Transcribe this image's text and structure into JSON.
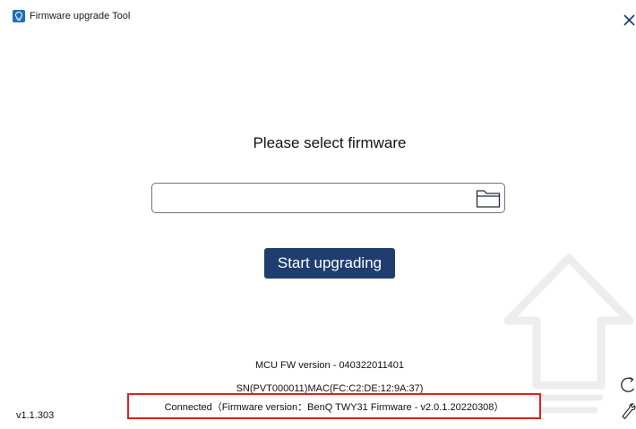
{
  "window": {
    "title": "Firmware upgrade Tool",
    "close_glyph": "X"
  },
  "main": {
    "heading": "Please select firmware",
    "firmware_path": "",
    "start_button_label": "Start upgrading"
  },
  "device": {
    "mcu_fw_version": "MCU FW version - 040322011401",
    "serial_mac": "SN(PVT000011)MAC(FC:C2:DE:12:9A:37)",
    "connection_status": "Connected（Firmware version：BenQ TWY31 Firmware - v2.0.1.20220308）"
  },
  "footer": {
    "app_version": "v1.1.303"
  },
  "icons": {
    "app": "app-icon",
    "close": "close-icon",
    "folder": "folder-icon",
    "upload_arrow": "upload-arrow-icon",
    "refresh": "refresh-icon",
    "tools": "wrench-icon"
  },
  "colors": {
    "button_bg": "#1f3d6e",
    "button_text": "#ffffff",
    "highlight_border": "#e02020",
    "field_border": "#6d7380",
    "watermark": "#ededed"
  }
}
